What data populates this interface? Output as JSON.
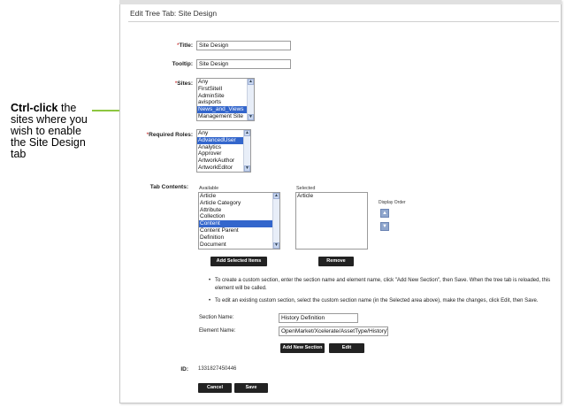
{
  "callout": {
    "bold": "Ctrl-click",
    "text": " the sites where you wish to enable the Site Design tab"
  },
  "header": {
    "title": "Edit Tree Tab: Site Design"
  },
  "form": {
    "title_label": "Title:",
    "title_value": "Site Design",
    "tooltip_label": "Tooltip:",
    "tooltip_value": "Site Design",
    "sites_label": "Sites:",
    "sites": [
      "Any",
      "FirstSiteII",
      "AdminSite",
      "avisports",
      "News_and_Views",
      "Management Site"
    ],
    "required_roles_label": "Required Roles:",
    "roles": [
      "Any",
      "AdvancedUser",
      "Analytics",
      "Approver",
      "ArtworkAuthor",
      "ArtworkEditor"
    ],
    "tab_contents_label": "Tab Contents:",
    "available_label": "Available",
    "available": [
      "Article",
      "Article Category",
      "Attribute",
      "Collection",
      "Content",
      "Content Parent",
      "Definition",
      "Document"
    ],
    "selected_label": "Selected",
    "selected": [
      "Article"
    ],
    "display_order_label": "Display Order",
    "add_selected_button": "Add Selected Items",
    "remove_button": "Remove",
    "bullet1": "To create a custom section, enter the section name and element name, click \"Add New Section\", then Save. When the tree tab is reloaded, this element will be called.",
    "bullet2": "To edit an existing custom section, select the custom section name (in the Selected area above), make the changes, click Edit, then Save.",
    "section_name_label": "Section Name:",
    "section_name_value": "History Definition",
    "element_name_label": "Element Name:",
    "element_name_value": "OpenMarket/Xcelerate/AssetType/HistoryVal",
    "add_new_section_button": "Add New Section",
    "edit_button": "Edit",
    "id_label": "ID:",
    "id_value": "1331827450446",
    "cancel_button": "Cancel",
    "save_button": "Save"
  },
  "colors": {
    "arrow": "#8dc63f",
    "selection": "#3366cc",
    "required": "#c00000"
  }
}
